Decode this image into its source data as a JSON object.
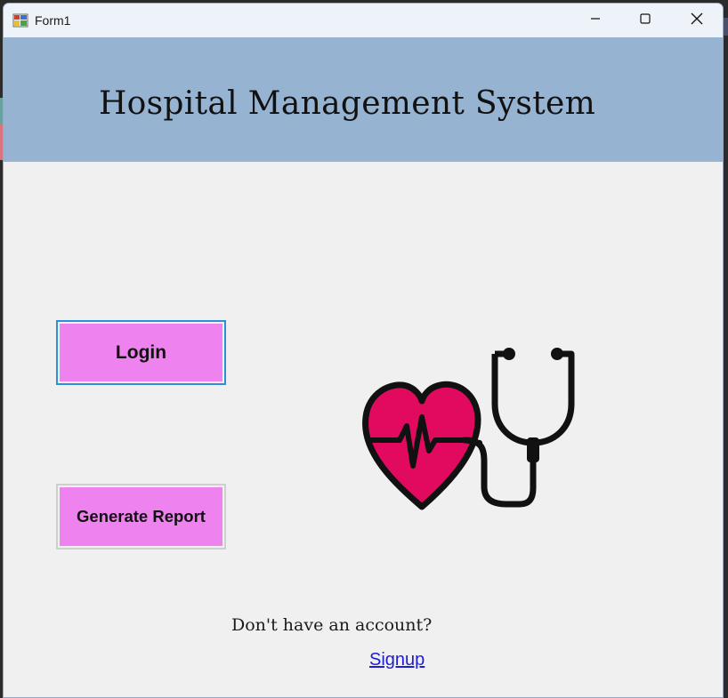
{
  "window": {
    "title": "Form1",
    "controls": [
      "minimize-icon",
      "maximize-icon",
      "close-icon"
    ]
  },
  "header": {
    "title": "Hospital Management System",
    "background": "#97b3d2"
  },
  "buttons": {
    "login": "Login",
    "report": "Generate Report",
    "color": "#ee82ee"
  },
  "illustration": {
    "icon": "heart-stethoscope-icon",
    "heart_color": "#e20a5f"
  },
  "footer": {
    "prompt": "Don't have an account?",
    "signup_link": "Signup"
  }
}
